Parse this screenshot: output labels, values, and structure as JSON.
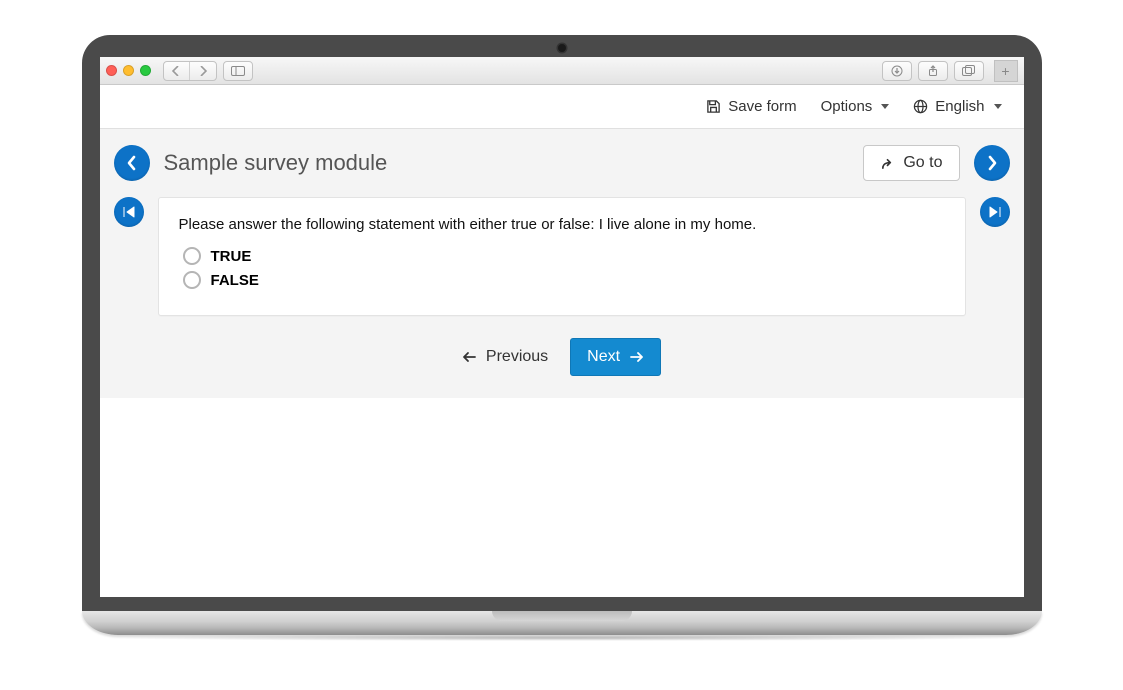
{
  "colors": {
    "accent": "#0d72c7",
    "primaryBtn": "#148ad0"
  },
  "topbar": {
    "save_label": "Save form",
    "options_label": "Options",
    "language_label": "English"
  },
  "survey": {
    "title": "Sample survey module",
    "goto_label": "Go to",
    "question": "Please answer the following statement with either true or false: I live alone in my home.",
    "options": {
      "true": "TRUE",
      "false": "FALSE"
    }
  },
  "nav": {
    "previous_label": "Previous",
    "next_label": "Next"
  }
}
